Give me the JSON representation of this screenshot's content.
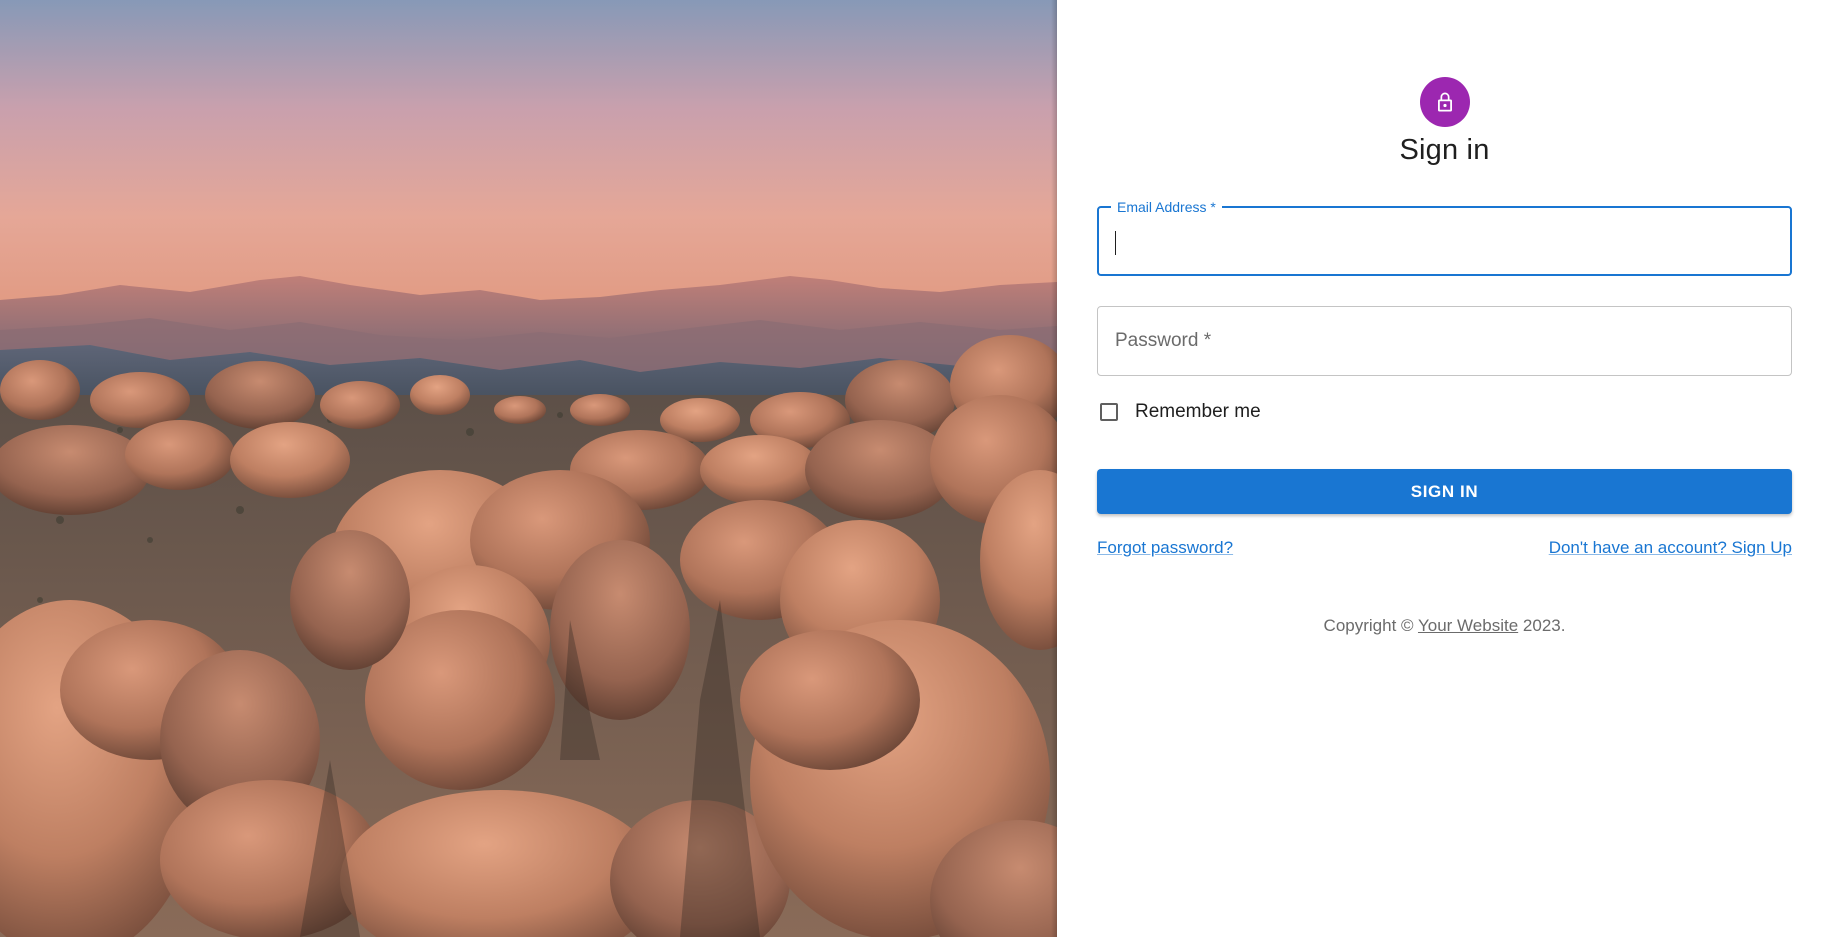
{
  "hero": {
    "image": "desert boulders and mountains at sunset"
  },
  "avatar": {
    "icon": "lock-icon",
    "color": "#9c27b0"
  },
  "title": "Sign in",
  "email": {
    "label": "Email Address *",
    "value": ""
  },
  "password": {
    "label": "Password *",
    "value": ""
  },
  "remember": {
    "label": "Remember me",
    "checked": false
  },
  "submit": {
    "label": "SIGN IN",
    "color": "#1976d2"
  },
  "links": {
    "forgot": "Forgot password?",
    "signup": "Don't have an account? Sign Up"
  },
  "copyright": {
    "prefix": "Copyright ©",
    "link": "Your Website",
    "suffix": "2023."
  }
}
